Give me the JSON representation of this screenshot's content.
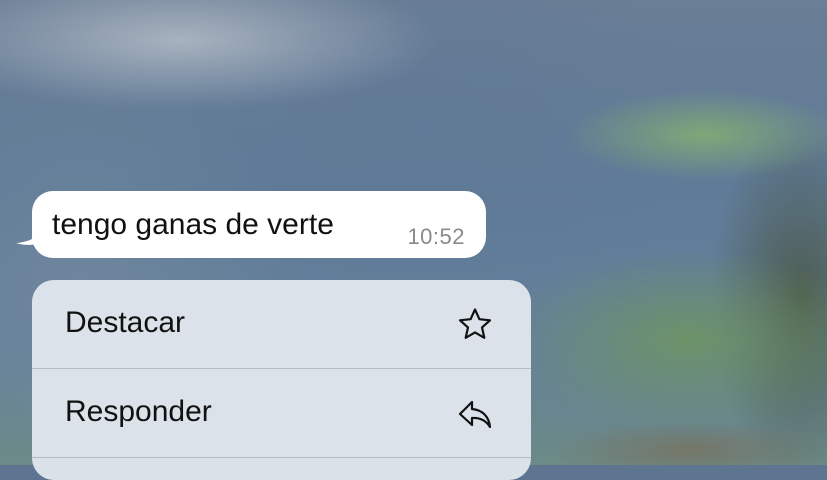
{
  "message": {
    "text": "tengo ganas de verte",
    "time": "10:52"
  },
  "context_menu": {
    "items": [
      {
        "label": "Destacar",
        "icon": "star-icon"
      },
      {
        "label": "Responder",
        "icon": "reply-icon"
      }
    ]
  },
  "colors": {
    "bubble": "#ffffff",
    "menu_background": "#e0e6ec",
    "text": "#111111",
    "timestamp": "#8a8a8e"
  }
}
